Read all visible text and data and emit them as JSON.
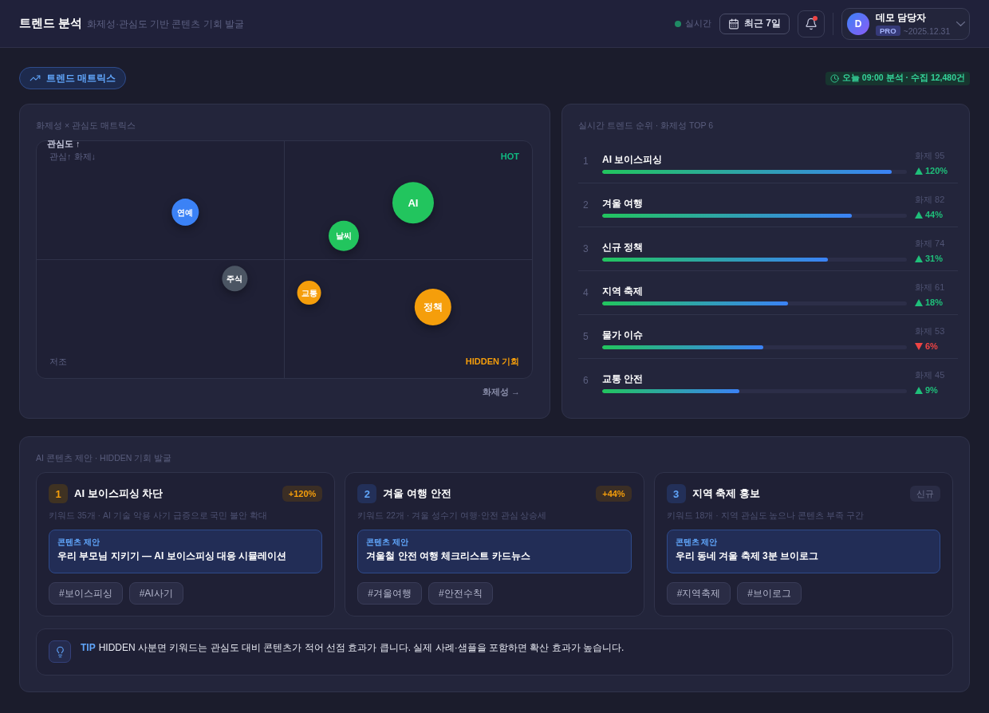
{
  "header": {
    "title": "트렌드 분석",
    "subtitle": "화제성·관심도 기반 콘텐츠 기회 발굴",
    "live": {
      "label": "실시간",
      "on": true
    },
    "period_button": "최근 7일",
    "notifications": {
      "unread": true
    },
    "user": {
      "initial": "D",
      "name": "데모 담당자",
      "plan": "PRO",
      "expiry": "~2025.12.31"
    }
  },
  "toolbar": {
    "tabs": [
      {
        "label": "트렌드 매트릭스",
        "selected": true
      }
    ],
    "status": "오늘 09:00 분석 · 수집 12,480건"
  },
  "matrix": {
    "title": "화제성 × 관심도 매트릭스",
    "y_axis_label": "관심도 ↑",
    "x_axis_label": "화제성 →",
    "quadrants": [
      {
        "label": "관심↑ 화제↓",
        "kind": "niche"
      },
      {
        "label": "HOT",
        "kind": "hot"
      },
      {
        "label": "저조",
        "kind": "low"
      },
      {
        "label": "HIDDEN 기회",
        "kind": "hidden"
      }
    ],
    "bubbles": [
      {
        "label": "연예",
        "color": "#3b82f6"
      },
      {
        "label": "주식",
        "color": "#4b5563"
      },
      {
        "label": "날씨",
        "color": "#22c55e"
      },
      {
        "label": "AI",
        "color": "#22c55e"
      },
      {
        "label": "교통",
        "color": "#f59e0b"
      },
      {
        "label": "정책",
        "color": "#f59e0b"
      }
    ]
  },
  "ranking": {
    "title": "실시간 트렌드 순위 · 화제성 TOP 6",
    "items": [
      {
        "rank": "1",
        "name": "AI 보이스피싱",
        "score": "화제 95",
        "level": 0.95,
        "kind": "rise",
        "change": "120%"
      },
      {
        "rank": "2",
        "name": "겨울 여행",
        "score": "화제 82",
        "level": 0.82,
        "kind": "rise",
        "change": "44%"
      },
      {
        "rank": "3",
        "name": "신규 정책",
        "score": "화제 74",
        "level": 0.74,
        "kind": "rise",
        "change": "31%"
      },
      {
        "rank": "4",
        "name": "지역 축제",
        "score": "화제 61",
        "level": 0.61,
        "kind": "rise",
        "change": "18%"
      },
      {
        "rank": "5",
        "name": "물가 이슈",
        "score": "화제 53",
        "level": 0.53,
        "kind": "fall",
        "change": "6%"
      },
      {
        "rank": "6",
        "name": "교통 안전",
        "score": "화제 45",
        "level": 0.45,
        "kind": "rise",
        "change": "9%"
      }
    ]
  },
  "suggestions": {
    "title": "AI 콘텐츠 제안 · HIDDEN 기회 발굴",
    "cards": [
      {
        "number": "1",
        "highlighted": true,
        "title": "AI 보이스피싱 차단",
        "badge": {
          "kind": "growth",
          "label": "+120%"
        },
        "description": "키워드 35개 · AI 기술 악용 사기 급증으로 국민 불안 확대",
        "proposal": {
          "label": "콘텐츠 제안",
          "text": "우리 부모님 지키기 — AI 보이스피싱 대응 시뮬레이션"
        },
        "tags": [
          "#보이스피싱",
          "#AI사기"
        ]
      },
      {
        "number": "2",
        "highlighted": false,
        "title": "겨울 여행 안전",
        "badge": {
          "kind": "growth",
          "label": "+44%"
        },
        "description": "키워드 22개 · 겨울 성수기 여행·안전 관심 상승세",
        "proposal": {
          "label": "콘텐츠 제안",
          "text": "겨울철 안전 여행 체크리스트 카드뉴스"
        },
        "tags": [
          "#겨울여행",
          "#안전수칙"
        ]
      },
      {
        "number": "3",
        "highlighted": false,
        "title": "지역 축제 홍보",
        "badge": {
          "kind": "new",
          "label": "신규"
        },
        "description": "키워드 18개 · 지역 관심도 높으나 콘텐츠 부족 구간",
        "proposal": {
          "label": "콘텐츠 제안",
          "text": "우리 동네 겨울 축제 3분 브이로그"
        },
        "tags": [
          "#지역축제",
          "#브이로그"
        ]
      }
    ],
    "tip": {
      "label": "TIP",
      "text": "HIDDEN 사분면 키워드는 관심도 대비 콘텐츠가 적어 선점 효과가 큽니다. 실제 사례·샘플을 포함하면 확산 효과가 높습니다."
    }
  }
}
